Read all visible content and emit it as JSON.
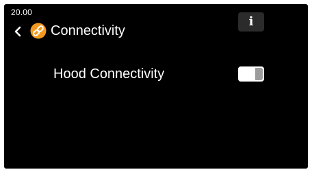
{
  "status_bar": {
    "time": "20.00"
  },
  "header": {
    "back_icon": "chevron-left-icon",
    "title_icon": "link-icon",
    "title": "Connectivity",
    "info_icon": "info-icon",
    "info_glyph": "i"
  },
  "settings": [
    {
      "label": "Hood Connectivity",
      "state": "off"
    }
  ],
  "colors": {
    "background": "#000000",
    "text": "#ffffff",
    "accent": "#f39a1e",
    "button_bg": "#2b2b2b",
    "toggle_track": "#ffffff",
    "toggle_knob": "#9c9c9c"
  }
}
